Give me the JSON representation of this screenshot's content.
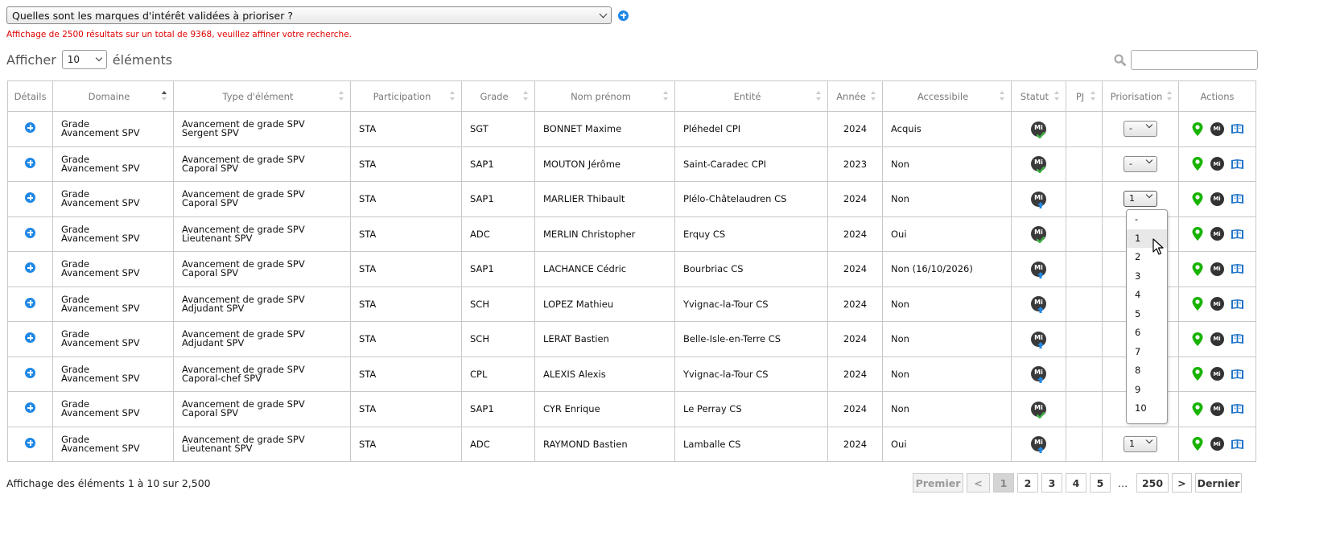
{
  "question": "Quelles sont les marques d'intérêt validées à prioriser ?",
  "warning": "Affichage de 2500 résultats sur un total de 9368, veuillez affiner votre recherche.",
  "length": {
    "prefix": "Afficher",
    "value": "10",
    "suffix": "éléments"
  },
  "search": {
    "value": ""
  },
  "columns": [
    "Détails",
    "Domaine",
    "Type d'élément",
    "Participation",
    "Grade",
    "Nom prénom",
    "Entité",
    "Année",
    "Accessibile",
    "Statut",
    "PJ",
    "Priorisation",
    "Actions"
  ],
  "rows": [
    {
      "domain1": "Grade",
      "domain2": "Avancement SPV",
      "type1": "Avancement de grade SPV",
      "type2": "Sergent SPV",
      "participation": "STA",
      "grade": "SGT",
      "name": "BONNET Maxime",
      "entity": "Pléhedel CPI",
      "year": "2024",
      "access": "Acquis",
      "status": "check",
      "prio": "-"
    },
    {
      "domain1": "Grade",
      "domain2": "Avancement SPV",
      "type1": "Avancement de grade SPV",
      "type2": "Caporal SPV",
      "participation": "STA",
      "grade": "SAP1",
      "name": "MOUTON Jérôme",
      "entity": "Saint-Caradec CPI",
      "year": "2023",
      "access": "Non",
      "status": "check",
      "prio": "-"
    },
    {
      "domain1": "Grade",
      "domain2": "Avancement SPV",
      "type1": "Avancement de grade SPV",
      "type2": "Caporal SPV",
      "participation": "STA",
      "grade": "SAP1",
      "name": "MARLIER Thibault",
      "entity": "Plélo-Châtelaudren CS",
      "year": "2024",
      "access": "Non",
      "status": "arrow",
      "prio": "1"
    },
    {
      "domain1": "Grade",
      "domain2": "Avancement SPV",
      "type1": "Avancement de grade SPV",
      "type2": "Lieutenant SPV",
      "participation": "STA",
      "grade": "ADC",
      "name": "MERLIN Christopher",
      "entity": "Erquy CS",
      "year": "2024",
      "access": "Oui",
      "status": "check",
      "prio": ""
    },
    {
      "domain1": "Grade",
      "domain2": "Avancement SPV",
      "type1": "Avancement de grade SPV",
      "type2": "Caporal SPV",
      "participation": "STA",
      "grade": "SAP1",
      "name": "LACHANCE Cédric",
      "entity": "Bourbriac CS",
      "year": "2024",
      "access": "Non (16/10/2026)",
      "status": "arrow",
      "prio": ""
    },
    {
      "domain1": "Grade",
      "domain2": "Avancement SPV",
      "type1": "Avancement de grade SPV",
      "type2": "Adjudant SPV",
      "participation": "STA",
      "grade": "SCH",
      "name": "LOPEZ Mathieu",
      "entity": "Yvignac-la-Tour CS",
      "year": "2024",
      "access": "Non",
      "status": "arrow",
      "prio": ""
    },
    {
      "domain1": "Grade",
      "domain2": "Avancement SPV",
      "type1": "Avancement de grade SPV",
      "type2": "Adjudant SPV",
      "participation": "STA",
      "grade": "SCH",
      "name": "LERAT Bastien",
      "entity": "Belle-Isle-en-Terre CS",
      "year": "2024",
      "access": "Non",
      "status": "arrow",
      "prio": ""
    },
    {
      "domain1": "Grade",
      "domain2": "Avancement SPV",
      "type1": "Avancement de grade SPV",
      "type2": "Caporal-chef SPV",
      "participation": "STA",
      "grade": "CPL",
      "name": "ALEXIS Alexis",
      "entity": "Yvignac-la-Tour CS",
      "year": "2024",
      "access": "Non",
      "status": "arrow",
      "prio": ""
    },
    {
      "domain1": "Grade",
      "domain2": "Avancement SPV",
      "type1": "Avancement de grade SPV",
      "type2": "Caporal SPV",
      "participation": "STA",
      "grade": "SAP1",
      "name": "CYR Enrique",
      "entity": "Le Perray CS",
      "year": "2024",
      "access": "Non",
      "status": "check",
      "prio": ""
    },
    {
      "domain1": "Grade",
      "domain2": "Avancement SPV",
      "type1": "Avancement de grade SPV",
      "type2": "Lieutenant SPV",
      "participation": "STA",
      "grade": "ADC",
      "name": "RAYMOND Bastien",
      "entity": "Lamballe CS",
      "year": "2024",
      "access": "Oui",
      "status": "arrow",
      "prio": "1"
    }
  ],
  "dropdown_options": [
    "-",
    "1",
    "2",
    "3",
    "4",
    "5",
    "6",
    "7",
    "8",
    "9",
    "10"
  ],
  "dropdown_highlight": "1",
  "mi_label": "Mi",
  "footer_info": "Affichage des éléments 1 à 10 sur 2,500",
  "pagination": {
    "first": "Premier",
    "prev": "<",
    "pages": [
      "1",
      "2",
      "3",
      "4",
      "5"
    ],
    "ellipsis": "…",
    "last_page": "250",
    "next": ">",
    "last": "Dernier",
    "current": "1"
  },
  "colors": {
    "accent": "#1f88e5",
    "warning": "#e00000",
    "check_green": "#3cb043",
    "arrow_blue": "#1f88e5",
    "pin_green": "#17b300"
  }
}
